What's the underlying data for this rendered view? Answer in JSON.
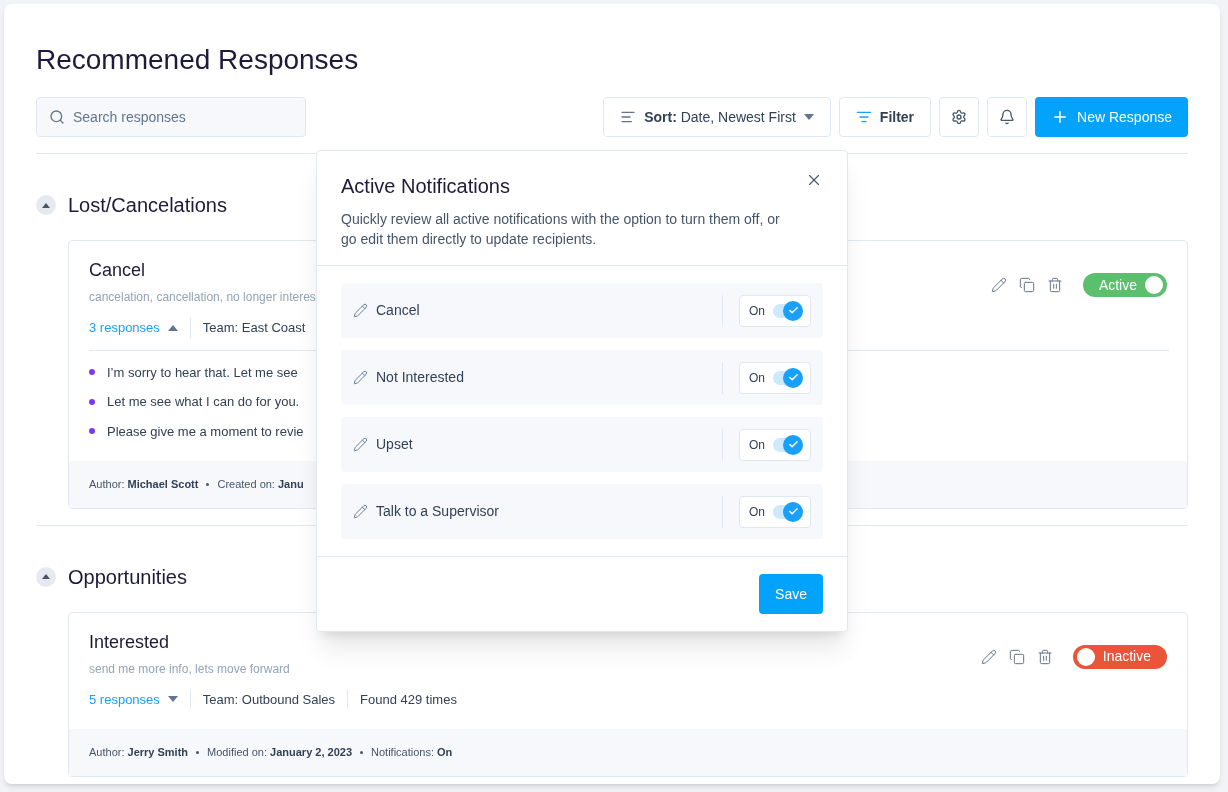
{
  "page": {
    "title": "Recommened Responses"
  },
  "toolbar": {
    "search": {
      "placeholder": "Search responses"
    },
    "sort": {
      "label": "Sort:",
      "value": "Date, Newest First"
    },
    "filter": "Filter",
    "new_button": "New Response"
  },
  "sections": [
    {
      "title": "Lost/Cancelations",
      "expanded": true,
      "cards": [
        {
          "title": "Cancel",
          "keywords": "cancelation, cancellation, no longer interes",
          "responses_link": "3 responses",
          "expanded": true,
          "team": "Team: East Coast",
          "status": {
            "label": "Active",
            "on": true
          },
          "responses": [
            "I’m sorry to hear that. Let me see",
            "Let me see what I can do for you.",
            "Please give me a moment to revie"
          ],
          "meta": [
            {
              "label": "Author:",
              "value": "Michael Scott"
            },
            {
              "label": "Created on:",
              "value": "Janu"
            }
          ]
        }
      ]
    },
    {
      "title": "Opportunities",
      "expanded": true,
      "cards": [
        {
          "title": "Interested",
          "keywords": "send me more info, lets move forward",
          "responses_link": "5 responses",
          "expanded": false,
          "team": "Team: Outbound Sales",
          "found": "Found 429 times",
          "status": {
            "label": "Inactive",
            "on": false
          },
          "meta": [
            {
              "label": "Author:",
              "value": "Jerry Smith"
            },
            {
              "label": "Modified on:",
              "value": "January 2, 2023"
            },
            {
              "label": "Notifications:",
              "value": "On"
            }
          ]
        }
      ]
    }
  ],
  "popup": {
    "title": "Active Notifications",
    "description": "Quickly review all active notifications with the option to turn them off, or go edit them directly to update recipients.",
    "items": [
      {
        "name": "Cancel",
        "label": "On",
        "on": true
      },
      {
        "name": "Not Interested",
        "label": "On",
        "on": true
      },
      {
        "name": "Upset",
        "label": "On",
        "on": true
      },
      {
        "name": "Talk to a Supervisor",
        "label": "On",
        "on": true
      }
    ],
    "save": "Save"
  }
}
